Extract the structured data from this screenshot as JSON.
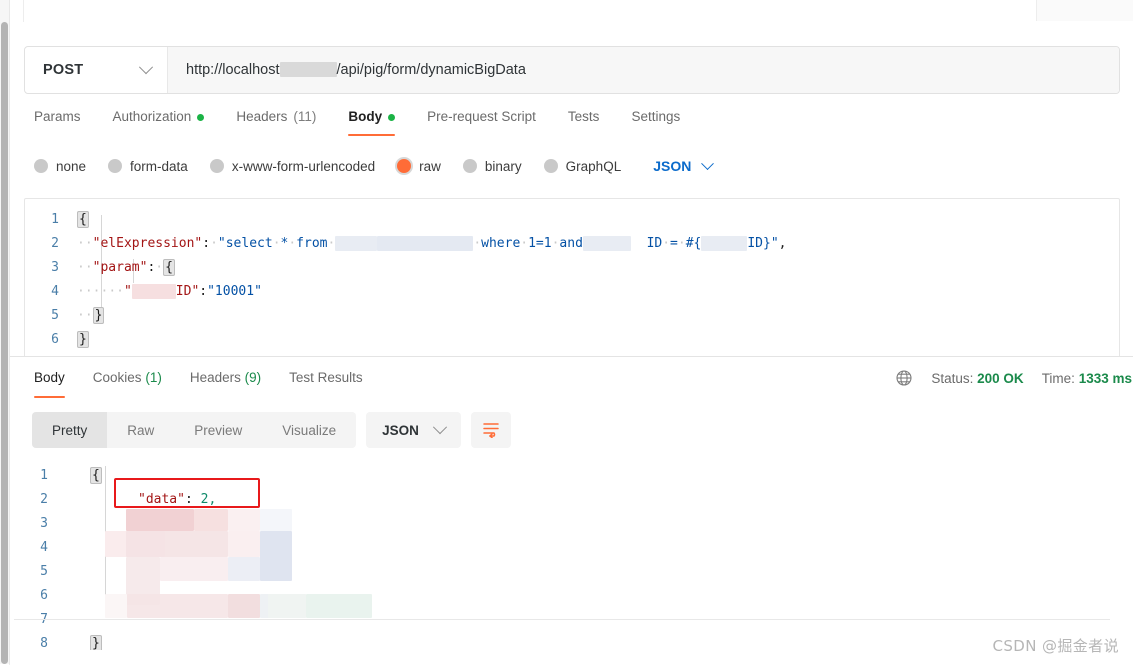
{
  "window": {
    "scrollbar": "vertical-scrollbar"
  },
  "request": {
    "method": "POST",
    "method_icon": "chevron-down-icon",
    "url_prefix": "http://localhost",
    "url_suffix": "/api/pig/form/dynamicBigData",
    "url_redacted": true,
    "tabs": [
      {
        "label": "Params",
        "active": false,
        "dot": false,
        "count": ""
      },
      {
        "label": "Authorization",
        "active": false,
        "dot": true,
        "count": ""
      },
      {
        "label": "Headers",
        "active": false,
        "dot": false,
        "count": "(11)"
      },
      {
        "label": "Body",
        "active": true,
        "dot": true,
        "count": ""
      },
      {
        "label": "Pre-request Script",
        "active": false,
        "dot": false,
        "count": ""
      },
      {
        "label": "Tests",
        "active": false,
        "dot": false,
        "count": ""
      },
      {
        "label": "Settings",
        "active": false,
        "dot": false,
        "count": ""
      }
    ],
    "body_types": [
      {
        "label": "none",
        "selected": false
      },
      {
        "label": "form-data",
        "selected": false
      },
      {
        "label": "x-www-form-urlencoded",
        "selected": false
      },
      {
        "label": "raw",
        "selected": true
      },
      {
        "label": "binary",
        "selected": false
      },
      {
        "label": "GraphQL",
        "selected": false
      }
    ],
    "format": "JSON",
    "format_icon": "chevron-down-icon",
    "body_lines": [
      {
        "n": "1",
        "text": "{"
      },
      {
        "n": "2",
        "text": "  \"elExpression\": \"select * from [REDACTED] where 1=1 and [REDACTED]ID = #{[REDACTED]ID}\","
      },
      {
        "n": "3",
        "text": "  \"param\": {"
      },
      {
        "n": "4",
        "text": "      \"[REDACTED]ID\":\"10001\""
      },
      {
        "n": "5",
        "text": "  }"
      },
      {
        "n": "6",
        "text": "}"
      }
    ]
  },
  "response": {
    "tabs": [
      {
        "label": "Body",
        "count": "",
        "active": true
      },
      {
        "label": "Cookies",
        "count": "(1)",
        "active": false
      },
      {
        "label": "Headers",
        "count": "(9)",
        "active": false
      },
      {
        "label": "Test Results",
        "count": "",
        "active": false
      }
    ],
    "globe_icon": "globe-icon",
    "status_label": "Status:",
    "status_value": "200 OK",
    "time_label": "Time:",
    "time_value": "1333 ms",
    "view_modes": [
      {
        "label": "Pretty",
        "active": true
      },
      {
        "label": "Raw",
        "active": false
      },
      {
        "label": "Preview",
        "active": false
      },
      {
        "label": "Visualize",
        "active": false
      }
    ],
    "format": "JSON",
    "format_icon": "chevron-down-icon",
    "wrap_icon": "wrap-lines-icon",
    "body_lines": [
      {
        "n": "1",
        "text": "{"
      },
      {
        "n": "2",
        "text": "    \"data\": 2,"
      },
      {
        "n": "3",
        "text": "[REDACTED]"
      },
      {
        "n": "4",
        "text": "[REDACTED]"
      },
      {
        "n": "5",
        "text": "[REDACTED]"
      },
      {
        "n": "6",
        "text": "[REDACTED]"
      },
      {
        "n": "7",
        "text": "[REDACTED]"
      },
      {
        "n": "8",
        "text": "}"
      }
    ],
    "highlight": {
      "name": "data-field-highlight",
      "color": "#e8191b",
      "target_key": "\"data\"",
      "target_value": "2,"
    }
  },
  "watermark": {
    "text": "CSDN @掘金者说"
  },
  "colors": {
    "accent": "#ff6c37",
    "success": "#1b8a4b",
    "link": "#0b6bcb",
    "annotation": "#e8191b"
  }
}
